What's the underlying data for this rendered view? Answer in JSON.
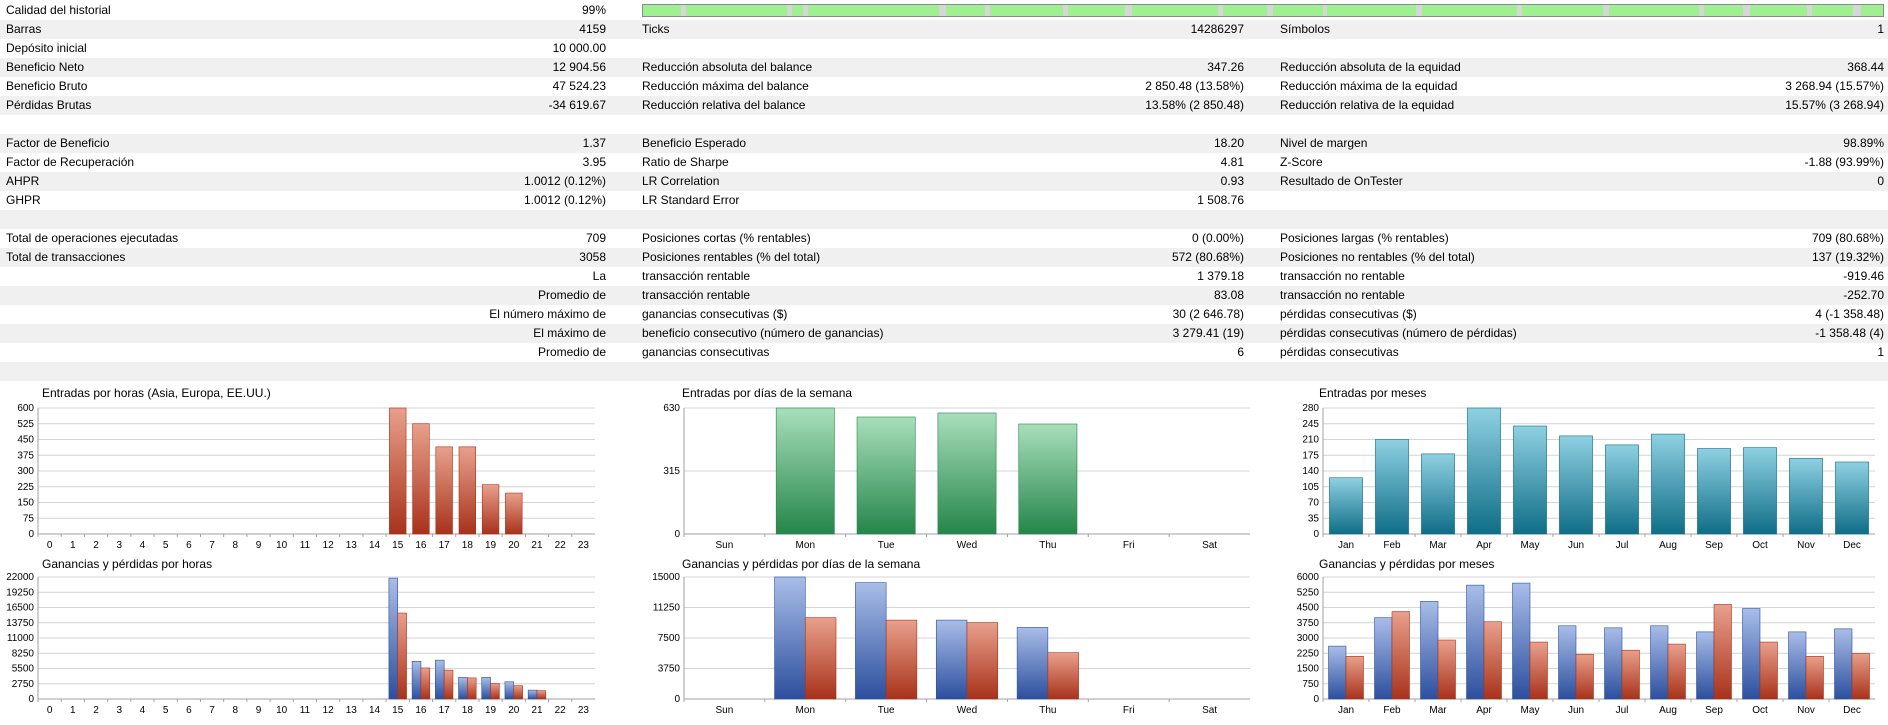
{
  "summary": {
    "quality_label": "Calidad del historial",
    "quality_value": "99%",
    "rows": [
      {
        "shade": true,
        "c1": "Barras",
        "v1": "4159",
        "c2": "Ticks",
        "v2": "14286297",
        "c3": "Símbolos",
        "v3": "1"
      },
      {
        "shade": false,
        "c1": "Depósito inicial",
        "v1": "10 000.00",
        "c2": "",
        "v2": "",
        "c3": "",
        "v3": ""
      },
      {
        "shade": true,
        "c1": "Beneficio Neto",
        "v1": "12 904.56",
        "c2": "Reducción absoluta del balance",
        "v2": "347.26",
        "c3": "Reducción absoluta de la equidad",
        "v3": "368.44"
      },
      {
        "shade": false,
        "c1": "Beneficio Bruto",
        "v1": "47 524.23",
        "c2": "Reducción máxima del balance",
        "v2": "2 850.48 (13.58%)",
        "c3": "Reducción máxima de la equidad",
        "v3": "3 268.94 (15.57%)"
      },
      {
        "shade": true,
        "c1": "Pérdidas Brutas",
        "v1": "-34 619.67",
        "c2": "Reducción relativa del balance",
        "v2": "13.58% (2 850.48)",
        "c3": "Reducción relativa de la equidad",
        "v3": "15.57% (3 268.94)"
      },
      {
        "shade": false,
        "c1": "",
        "v1": "",
        "c2": "",
        "v2": "",
        "c3": "",
        "v3": ""
      },
      {
        "shade": true,
        "c1": "Factor de Beneficio",
        "v1": "1.37",
        "c2": "Beneficio Esperado",
        "v2": "18.20",
        "c3": "Nivel de margen",
        "v3": "98.89%"
      },
      {
        "shade": false,
        "c1": "Factor de Recuperación",
        "v1": "3.95",
        "c2": "Ratio de Sharpe",
        "v2": "4.81",
        "c3": "Z-Score",
        "v3": "-1.88 (93.99%)"
      },
      {
        "shade": true,
        "c1": "AHPR",
        "v1": "1.0012 (0.12%)",
        "c2": "LR Correlation",
        "v2": "0.93",
        "c3": "Resultado de OnTester",
        "v3": "0"
      },
      {
        "shade": false,
        "c1": "GHPR",
        "v1": "1.0012 (0.12%)",
        "c2": "LR Standard Error",
        "v2": "1 508.76",
        "c3": "",
        "v3": ""
      },
      {
        "shade": true,
        "c1": "",
        "v1": "",
        "c2": "",
        "v2": "",
        "c3": "",
        "v3": ""
      },
      {
        "shade": false,
        "c1": "Total de operaciones ejecutadas",
        "v1": "709",
        "c2": "Posiciones cortas (% rentables)",
        "v2": "0 (0.00%)",
        "c3": "Posiciones largas (% rentables)",
        "v3": "709 (80.68%)"
      },
      {
        "shade": true,
        "c1": "Total de transacciones",
        "v1": "3058",
        "c2": "Posiciones rentables (% del total)",
        "v2": "572 (80.68%)",
        "c3": "Posiciones no rentables (% del total)",
        "v3": "137 (19.32%)"
      },
      {
        "shade": false,
        "c1": "",
        "v1": "La",
        "c2": "transacción rentable",
        "v2": "1 379.18",
        "c3": "transacción no rentable",
        "v3": "-919.46"
      },
      {
        "shade": true,
        "c1": "",
        "v1": "Promedio de",
        "c2": "transacción rentable",
        "v2": "83.08",
        "c3": "transacción no rentable",
        "v3": "-252.70"
      },
      {
        "shade": false,
        "c1": "",
        "v1": "El número máximo de",
        "c2": "ganancias consecutivas ($)",
        "v2": "30 (2 646.78)",
        "c3": "pérdidas consecutivas ($)",
        "v3": "4 (-1 358.48)"
      },
      {
        "shade": true,
        "c1": "",
        "v1": "El máximo de",
        "c2": "beneficio consecutivo (número de ganancias)",
        "v2": "3 279.41 (19)",
        "c3": "pérdidas consecutivas (número de pérdidas)",
        "v3": "-1 358.48 (4)"
      },
      {
        "shade": false,
        "c1": "",
        "v1": "Promedio de",
        "c2": "ganancias consecutivas",
        "v2": "6",
        "c3": "pérdidas consecutivas",
        "v3": "1"
      },
      {
        "shade": true,
        "c1": "",
        "v1": "",
        "c2": "",
        "v2": "",
        "c3": "",
        "v3": ""
      }
    ]
  },
  "colors": {
    "quality_bar": "#9ef090",
    "quality_gap": "#d6d6d6",
    "red_bar": "#c0472f",
    "green_bar": "#36a261",
    "teal_bar": "#1f8fa6",
    "blue_bar": "#4469b5",
    "grid": "#d4d4d4"
  },
  "chart_data": [
    {
      "type": "bar",
      "title": "Entradas por horas (Asia, Europa, EE.UU.)",
      "categories": [
        "0",
        "1",
        "2",
        "3",
        "4",
        "5",
        "6",
        "7",
        "8",
        "9",
        "10",
        "11",
        "12",
        "13",
        "14",
        "15",
        "16",
        "17",
        "18",
        "19",
        "20",
        "21",
        "22",
        "23"
      ],
      "yticks": [
        "0",
        "75",
        "150",
        "225",
        "300",
        "375",
        "450",
        "525",
        "600"
      ],
      "ylim": [
        0,
        600
      ],
      "series": [
        {
          "color": "red_bar",
          "values": [
            0,
            0,
            0,
            0,
            0,
            0,
            0,
            0,
            0,
            0,
            0,
            0,
            0,
            0,
            0,
            600,
            525,
            415,
            415,
            235,
            195,
            0,
            0,
            0
          ]
        }
      ]
    },
    {
      "type": "bar",
      "title": "Entradas por días de la semana",
      "categories": [
        "Sun",
        "Mon",
        "Tue",
        "Wed",
        "Thu",
        "Fri",
        "Sat"
      ],
      "yticks": [
        "0",
        "315",
        "630"
      ],
      "ylim": [
        0,
        630
      ],
      "series": [
        {
          "color": "green_bar",
          "values": [
            0,
            630,
            585,
            605,
            550,
            0,
            0
          ]
        }
      ]
    },
    {
      "type": "bar",
      "title": "Entradas por meses",
      "categories": [
        "Jan",
        "Feb",
        "Mar",
        "Apr",
        "May",
        "Jun",
        "Jul",
        "Aug",
        "Sep",
        "Oct",
        "Nov",
        "Dec"
      ],
      "yticks": [
        "0",
        "35",
        "70",
        "105",
        "140",
        "175",
        "210",
        "245",
        "280"
      ],
      "ylim": [
        0,
        280
      ],
      "series": [
        {
          "color": "teal_bar",
          "values": [
            125,
            210,
            178,
            280,
            240,
            218,
            198,
            222,
            190,
            192,
            168,
            160
          ]
        }
      ]
    },
    {
      "type": "bar",
      "title": "Ganancias y pérdidas por horas",
      "categories": [
        "0",
        "1",
        "2",
        "3",
        "4",
        "5",
        "6",
        "7",
        "8",
        "9",
        "10",
        "11",
        "12",
        "13",
        "14",
        "15",
        "16",
        "17",
        "18",
        "19",
        "20",
        "21",
        "22",
        "23"
      ],
      "yticks": [
        "0",
        "2750",
        "5500",
        "8250",
        "11000",
        "13750",
        "16500",
        "19250",
        "22000"
      ],
      "ylim": [
        0,
        22000
      ],
      "series": [
        {
          "color": "blue_bar",
          "values": [
            0,
            0,
            0,
            0,
            0,
            0,
            0,
            0,
            0,
            0,
            0,
            0,
            0,
            0,
            0,
            21800,
            6800,
            7000,
            3900,
            3900,
            3100,
            1600,
            0,
            0
          ]
        },
        {
          "color": "red_bar",
          "values": [
            0,
            0,
            0,
            0,
            0,
            0,
            0,
            0,
            0,
            0,
            0,
            0,
            0,
            0,
            0,
            15500,
            5600,
            5200,
            3800,
            2800,
            2400,
            1500,
            0,
            0
          ]
        }
      ]
    },
    {
      "type": "bar",
      "title": "Ganancias y pérdidas por días de la semana",
      "categories": [
        "Sun",
        "Mon",
        "Tue",
        "Wed",
        "Thu",
        "Fri",
        "Sat"
      ],
      "yticks": [
        "0",
        "3750",
        "7500",
        "11250",
        "15000"
      ],
      "ylim": [
        0,
        15000
      ],
      "series": [
        {
          "color": "blue_bar",
          "values": [
            0,
            15000,
            14300,
            9700,
            8800,
            0,
            0
          ]
        },
        {
          "color": "red_bar",
          "values": [
            0,
            10000,
            9700,
            9400,
            5700,
            0,
            0
          ]
        }
      ]
    },
    {
      "type": "bar",
      "title": "Ganancias y pérdidas por meses",
      "categories": [
        "Jan",
        "Feb",
        "Mar",
        "Apr",
        "May",
        "Jun",
        "Jul",
        "Aug",
        "Sep",
        "Oct",
        "Nov",
        "Dec"
      ],
      "yticks": [
        "0",
        "750",
        "1500",
        "2250",
        "3000",
        "3750",
        "4500",
        "5250",
        "6000"
      ],
      "ylim": [
        0,
        6000
      ],
      "series": [
        {
          "color": "blue_bar",
          "values": [
            2600,
            4000,
            4800,
            5600,
            5700,
            3600,
            3500,
            3600,
            3300,
            4450,
            3300,
            3450
          ]
        },
        {
          "color": "red_bar",
          "values": [
            2100,
            4300,
            2900,
            3800,
            2800,
            2200,
            2400,
            2700,
            4650,
            2800,
            2100,
            2250
          ]
        }
      ]
    }
  ]
}
